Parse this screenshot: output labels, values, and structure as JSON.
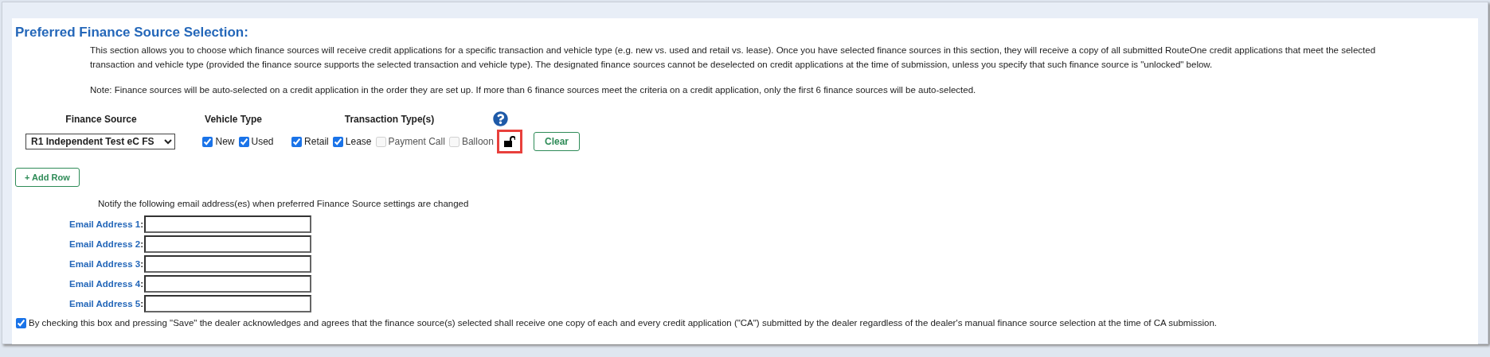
{
  "section": {
    "title": "Preferred Finance Source Selection:",
    "paragraphs": [
      "This section allows you to choose which finance sources will receive credit applications for a specific transaction and vehicle type (e.g. new vs. used and retail vs. lease). Once you have selected finance sources in this section, they will receive a copy of all submitted RouteOne credit applications that meet the selected transaction and vehicle type (provided the finance source supports the selected transaction and vehicle type). The designated finance sources cannot be deselected on credit applications at the time of submission, unless you specify that such finance source is \"unlocked\" below.",
      "Note: Finance sources will be auto-selected on a credit application in the order they are set up. If more than 6 finance sources meet the criteria on a credit application, only the first 6 finance sources will be auto-selected."
    ]
  },
  "table": {
    "columns": [
      "Finance Source",
      "Vehicle Type",
      "Transaction Type(s)"
    ],
    "rows": [
      {
        "finance_source": "R1 Independent Test eC FS",
        "vehicle_types": [
          {
            "label": "New",
            "checked": true,
            "disabled": false
          },
          {
            "label": "Used",
            "checked": true,
            "disabled": false
          }
        ],
        "transaction_types": [
          {
            "label": "Retail",
            "checked": true,
            "disabled": false
          },
          {
            "label": "Lease",
            "checked": true,
            "disabled": false
          },
          {
            "label": "Payment Call",
            "checked": false,
            "disabled": true
          },
          {
            "label": "Balloon",
            "checked": false,
            "disabled": true
          }
        ],
        "locked": false,
        "lock_highlighted": true,
        "clear_button": "Clear"
      }
    ]
  },
  "add_row_button": "+ Add Row",
  "notify": {
    "text": "Notify the following email address(es) when preferred Finance Source settings are changed",
    "fields": [
      {
        "label": "Email Address 1",
        "separator": ":"
      },
      {
        "label": "Email Address 2",
        "separator": ":"
      },
      {
        "label": "Email Address 3",
        "separator": ":"
      },
      {
        "label": "Email Address 4",
        "separator": ":"
      },
      {
        "label": "Email Address 5",
        "separator": ":"
      }
    ]
  },
  "acknowledgement": {
    "checked": true,
    "text": "By checking this box and pressing \"Save\" the dealer acknowledges and agrees that the finance source(s) selected shall receive one copy of each and every credit application (\"CA\") submitted by the dealer regardless of the dealer's manual finance source selection at the time of CA submission."
  }
}
